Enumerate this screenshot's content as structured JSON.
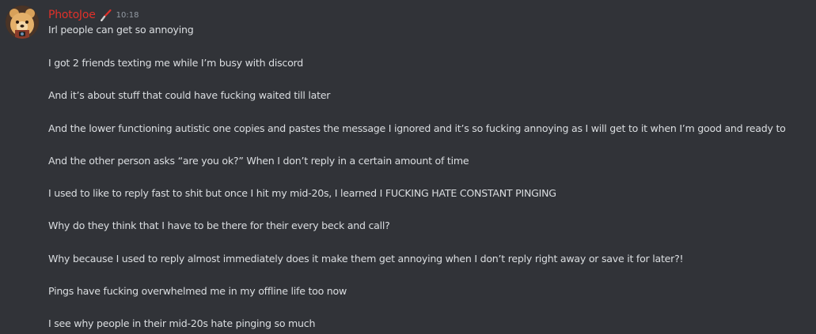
{
  "message": {
    "author": {
      "name": "PhotoJoe",
      "name_color": "#e0312a",
      "role_icon": "paintbrush-icon"
    },
    "timestamp": "10:18",
    "lines": [
      "Irl people can get so annoying",
      "I got 2 friends texting me while I’m busy with discord",
      "And it’s about stuff that could have fucking waited till later",
      "And the lower functioning autistic one copies and pastes the message I ignored and it’s so fucking annoying as I will get to it when I’m good and ready to",
      "And the other person asks “are you ok?” When I don’t reply in a certain amount of time",
      "I used to like to reply fast to shit but once I hit my mid-20s, I learned I FUCKING HATE CONSTANT PINGING",
      "Why do they think that I have to be there for their every beck and call?",
      "Why because I used to reply almost immediately does it make them get annoying when I don’t reply right away or save it for later?!",
      "Pings have fucking overwhelmed me in my offline life too now",
      "I see why people in their mid-20s hate pinging so much"
    ]
  },
  "colors": {
    "background": "#313338",
    "text": "#dbdee1",
    "timestamp": "#949ba4"
  }
}
